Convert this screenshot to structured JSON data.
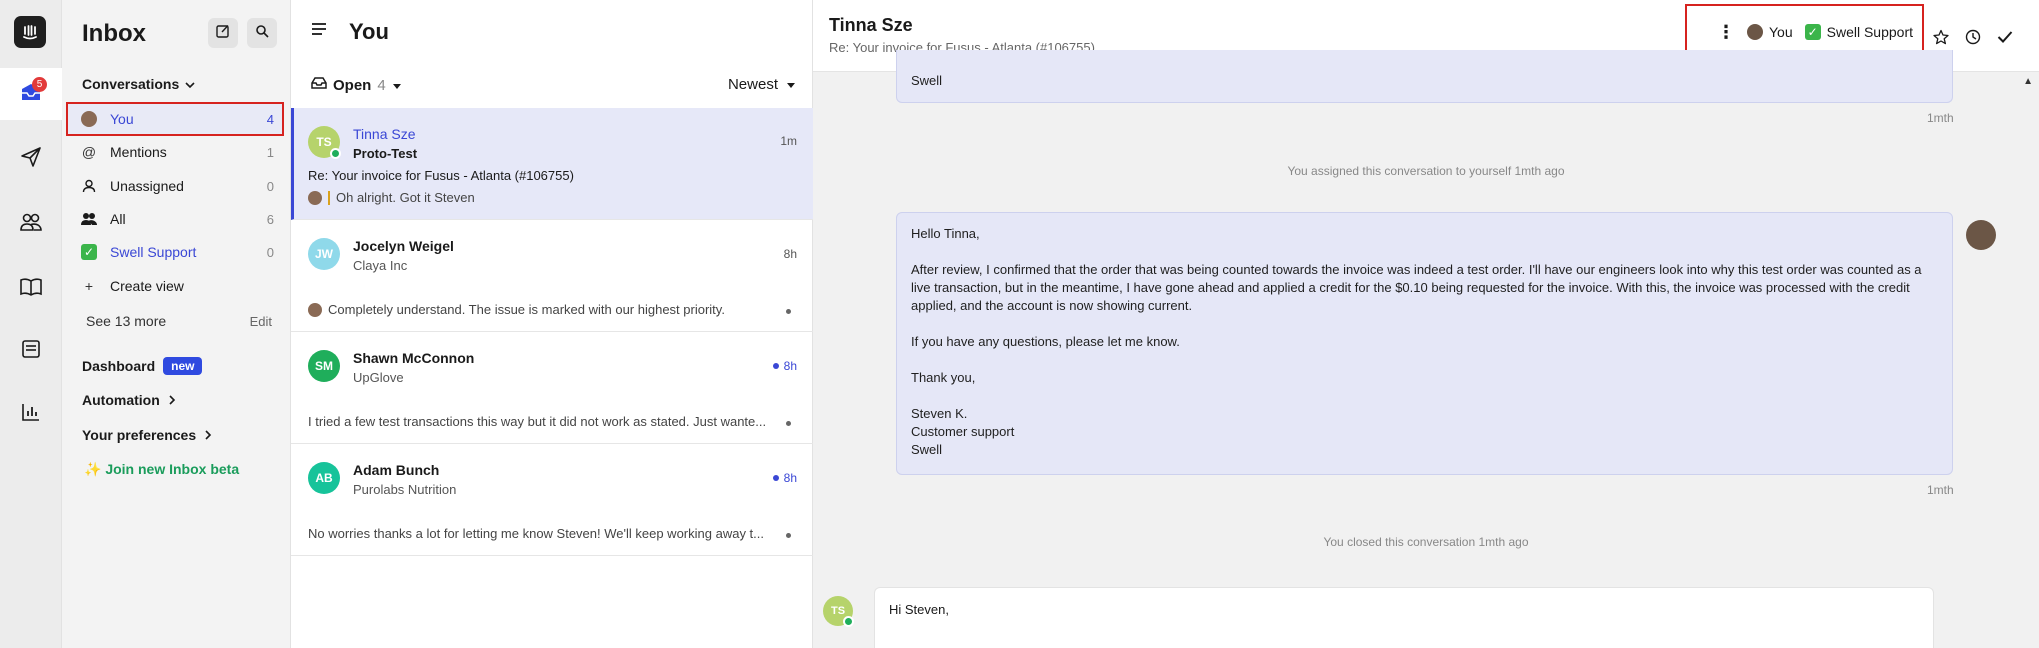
{
  "rail": {
    "items": [
      {
        "name": "logo",
        "icon": "intercom-logo"
      },
      {
        "name": "inbox",
        "icon": "inbox-icon",
        "badge": "5"
      },
      {
        "name": "outbound",
        "icon": "paper-plane-icon"
      },
      {
        "name": "contacts",
        "icon": "people-icon"
      },
      {
        "name": "knowledge",
        "icon": "book-icon"
      },
      {
        "name": "reports-list",
        "icon": "list-icon"
      },
      {
        "name": "reports",
        "icon": "bar-chart-icon"
      }
    ]
  },
  "sidebar": {
    "title": "Inbox",
    "section": "Conversations",
    "items": [
      {
        "label": "You",
        "count": "4",
        "icon": "avatar"
      },
      {
        "label": "Mentions",
        "count": "1",
        "icon": "at-icon"
      },
      {
        "label": "Unassigned",
        "count": "0",
        "icon": "person-icon"
      },
      {
        "label": "All",
        "count": "6",
        "icon": "group-icon"
      },
      {
        "label": "Swell Support",
        "count": "0",
        "icon": "check-box-icon"
      },
      {
        "label": "Create view",
        "count": "",
        "icon": "plus-icon"
      }
    ],
    "see_more": "See 13 more",
    "edit": "Edit",
    "dashboard": "Dashboard",
    "dashboard_badge": "new",
    "automation": "Automation",
    "preferences": "Your preferences",
    "beta": "✨ Join new Inbox beta"
  },
  "list": {
    "title": "You",
    "filter_label": "Open",
    "filter_count": "4",
    "sort_label": "Newest",
    "conversations": [
      {
        "initials": "TS",
        "name": "Tinna Sze",
        "company": "Proto-Test",
        "time": "1m",
        "subject": "Re: Your invoice for Fusus - Atlanta (#106755)",
        "preview": "Oh alright. Got it Steven",
        "color": "#b6d36b"
      },
      {
        "initials": "JW",
        "name": "Jocelyn Weigel",
        "company": "Claya Inc",
        "time": "8h",
        "subject": "",
        "preview": "Completely understand. The issue is marked with our highest priority.",
        "color": "#8fd9ea"
      },
      {
        "initials": "SM",
        "name": "Shawn McConnon",
        "company": "UpGlove",
        "time": "8h",
        "subject": "",
        "preview": "I tried a few test transactions this way but it did not work as stated. Just wante...",
        "color": "#1fae5b"
      },
      {
        "initials": "AB",
        "name": "Adam Bunch",
        "company": "Purolabs Nutrition",
        "time": "8h",
        "subject": "",
        "preview": "No worries thanks a lot for letting me know Steven! We'll keep working away t...",
        "color": "#17c39a"
      }
    ]
  },
  "detail": {
    "name": "Tinna Sze",
    "subject": "Re: Your invoice for Fusus - Atlanta (#106755)",
    "assignee": "You",
    "team": "Swell Support",
    "top_bubble_tail": "Swell",
    "top_bubble_time": "1mth",
    "sys1": "You assigned this conversation to yourself 1mth ago",
    "msg": {
      "greeting": "Hello Tinna,",
      "body": "After review, I confirmed that the order that was being counted towards the invoice was indeed a test order. I'll have our engineers look into why this test order was counted as a live transaction, but in the meantime, I have gone ahead and applied a credit for the $0.10 being requested for the invoice. With this, the invoice was processed with the credit applied, and the account is now showing current.",
      "questions": "If you have any questions, please let me know.",
      "thanks": "Thank you,",
      "sig1": "Steven K.",
      "sig2": "Customer support",
      "sig3": "Swell",
      "time": "1mth"
    },
    "sys2": "You closed this conversation 1mth ago",
    "customer_initials": "TS",
    "customer_msg": "Hi Steven,"
  }
}
